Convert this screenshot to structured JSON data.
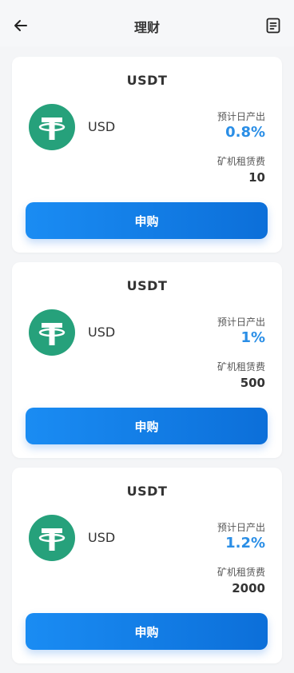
{
  "header": {
    "title": "理财",
    "back_icon": "arrow-left-icon",
    "doc_icon": "document-icon"
  },
  "labels": {
    "daily_yield": "预计日产出",
    "rent_fee": "矿机租赁费"
  },
  "products": [
    {
      "title": "USDT",
      "unit": "USD",
      "daily_yield": "0.8%",
      "rent_fee": "10",
      "button": "申购",
      "icon": "tether-usdt-icon"
    },
    {
      "title": "USDT",
      "unit": "USD",
      "daily_yield": "1%",
      "rent_fee": "500",
      "button": "申购",
      "icon": "tether-usdt-icon"
    },
    {
      "title": "USDT",
      "unit": "USD",
      "daily_yield": "1.2%",
      "rent_fee": "2000",
      "button": "申购",
      "icon": "tether-usdt-icon"
    }
  ],
  "colors": {
    "accent": "#2a8ee6",
    "button_start": "#1a8cf3",
    "button_end": "#0c6fd9",
    "coin": "#26a17b"
  }
}
